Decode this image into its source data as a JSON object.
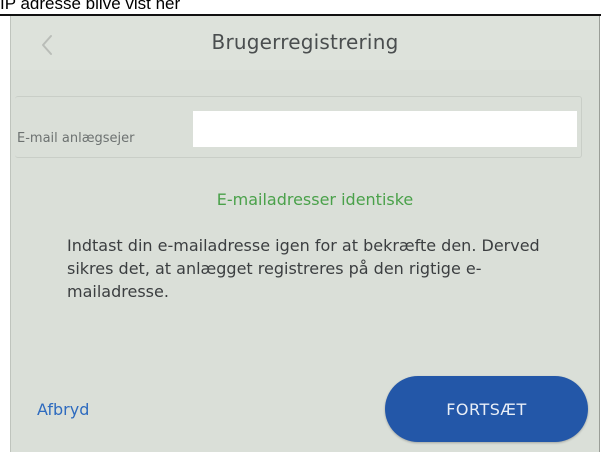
{
  "caption": "IP adresse blive vist her",
  "header": {
    "title": "Brugerregistrering",
    "back_icon": "chevron-left-icon"
  },
  "form": {
    "email_label": "E-mail anlægsejer",
    "email_value": ""
  },
  "status": {
    "text": "E-mailadresser identiske",
    "color": "#4aa14a"
  },
  "info_text": "Indtast din e-mailadresse igen for at bekræfte den. Derved sikres det, at anlægget registreres på den rigtige e-mailadresse.",
  "footer": {
    "cancel_label": "Afbryd",
    "continue_label": "FORTSÆT"
  },
  "colors": {
    "screen_background": "#dadfd8",
    "primary_button": "#2357a8",
    "link": "#2e6bbf",
    "title_text": "#4a4e4f"
  }
}
